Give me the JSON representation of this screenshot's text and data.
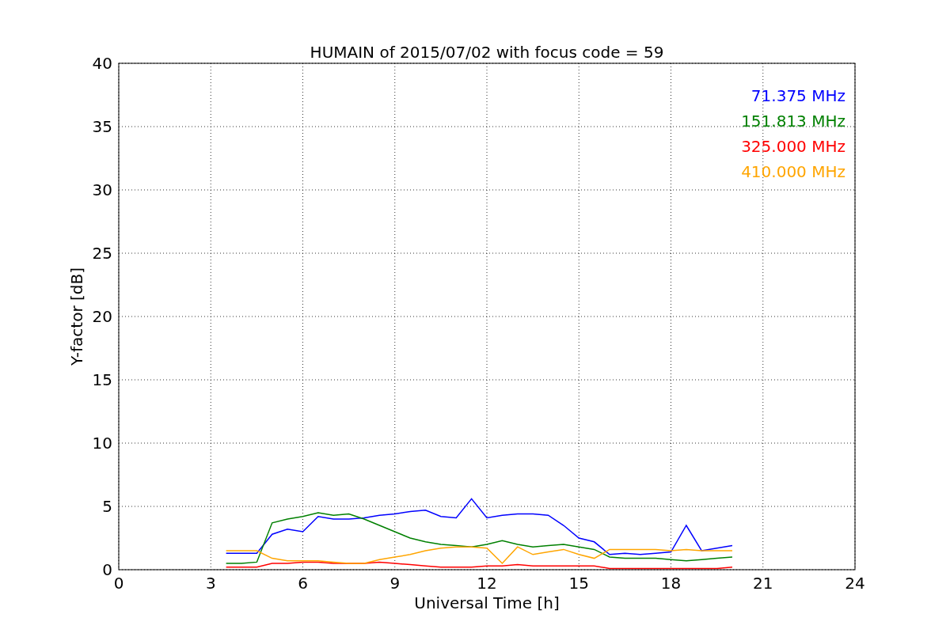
{
  "chart_data": {
    "type": "line",
    "title": "HUMAIN of 2015/07/02 with focus code = 59",
    "xlabel": "Universal Time [h]",
    "ylabel": "Y-factor [dB]",
    "x": [
      3.5,
      4,
      4.5,
      5,
      5.5,
      6,
      6.5,
      7,
      7.5,
      8,
      8.5,
      9,
      9.5,
      10,
      10.5,
      11,
      11.5,
      12,
      12.5,
      13,
      13.5,
      14,
      14.5,
      15,
      15.5,
      16,
      16.5,
      17,
      17.5,
      18,
      18.5,
      19,
      19.5,
      20
    ],
    "series": [
      {
        "name": "71.375 MHz",
        "color": "#0000ff",
        "values": [
          1.3,
          1.3,
          1.3,
          2.8,
          3.2,
          3.0,
          4.2,
          4.0,
          4.0,
          4.1,
          4.3,
          4.4,
          4.6,
          4.7,
          4.2,
          4.1,
          5.6,
          4.1,
          4.3,
          4.4,
          4.4,
          4.3,
          3.5,
          2.5,
          2.2,
          1.2,
          1.3,
          1.2,
          1.3,
          1.4,
          3.5,
          1.5,
          1.7,
          1.9
        ]
      },
      {
        "name": "151.813 MHz",
        "color": "#008000",
        "values": [
          0.5,
          0.5,
          0.6,
          3.7,
          4.0,
          4.2,
          4.5,
          4.3,
          4.4,
          4.0,
          3.5,
          3.0,
          2.5,
          2.2,
          2.0,
          1.9,
          1.8,
          2.0,
          2.3,
          2.0,
          1.8,
          1.9,
          2.0,
          1.8,
          1.6,
          1.0,
          0.9,
          0.9,
          0.9,
          0.8,
          0.7,
          0.8,
          0.9,
          1.0
        ]
      },
      {
        "name": "325.000 MHz",
        "color": "#ff0000",
        "values": [
          0.2,
          0.2,
          0.2,
          0.5,
          0.5,
          0.6,
          0.6,
          0.5,
          0.5,
          0.5,
          0.6,
          0.5,
          0.4,
          0.3,
          0.2,
          0.2,
          0.2,
          0.3,
          0.3,
          0.4,
          0.3,
          0.3,
          0.3,
          0.3,
          0.3,
          0.1,
          0.1,
          0.1,
          0.1,
          0.1,
          0.1,
          0.1,
          0.1,
          0.2
        ]
      },
      {
        "name": "410.000 MHz",
        "color": "#ffa500",
        "values": [
          1.5,
          1.5,
          1.5,
          0.9,
          0.7,
          0.7,
          0.7,
          0.6,
          0.5,
          0.5,
          0.8,
          1.0,
          1.2,
          1.5,
          1.7,
          1.8,
          1.8,
          1.7,
          0.5,
          1.8,
          1.2,
          1.4,
          1.6,
          1.2,
          0.9,
          1.6,
          1.6,
          1.6,
          1.6,
          1.5,
          1.6,
          1.5,
          1.5,
          1.5
        ]
      }
    ],
    "grid": true,
    "xlim": [
      0,
      24
    ],
    "ylim": [
      0,
      40
    ],
    "xticks": [
      0,
      3,
      6,
      9,
      12,
      15,
      18,
      21,
      24
    ],
    "yticks": [
      0,
      5,
      10,
      15,
      20,
      25,
      30,
      35,
      40
    ]
  }
}
